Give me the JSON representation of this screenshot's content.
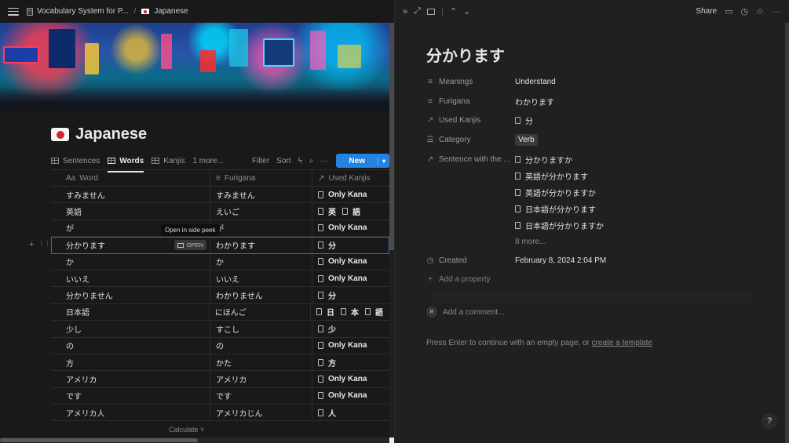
{
  "breadcrumb": {
    "workspace": "Vocabulary System for P...",
    "page": "Japanese"
  },
  "page": {
    "title": "Japanese"
  },
  "views": {
    "tabs": [
      {
        "label": "Sentences",
        "active": false
      },
      {
        "label": "Words",
        "active": true
      },
      {
        "label": "Kanjis",
        "active": false
      }
    ],
    "more": "1 more...",
    "filter": "Filter",
    "sort": "Sort",
    "new": "New"
  },
  "table": {
    "headers": [
      "Word",
      "Furigana",
      "Used Kanjis"
    ],
    "header_prefix": "Aa",
    "rows": [
      {
        "word": "すみません",
        "furigana": "すみません",
        "kanjis": [],
        "kana": "Only Kana"
      },
      {
        "word": "英語",
        "furigana": "えいご",
        "kanjis": [
          "英",
          "語"
        ],
        "kana": ""
      },
      {
        "word": "が",
        "furigana": "が",
        "kanjis": [],
        "kana": "Only Kana"
      },
      {
        "word": "分かります",
        "furigana": "わかります",
        "kanjis": [
          "分"
        ],
        "kana": ""
      },
      {
        "word": "か",
        "furigana": "か",
        "kanjis": [],
        "kana": "Only Kana"
      },
      {
        "word": "いいえ",
        "furigana": "いいえ",
        "kanjis": [],
        "kana": "Only Kana"
      },
      {
        "word": "分かりません",
        "furigana": "わかりません",
        "kanjis": [
          "分"
        ],
        "kana": ""
      },
      {
        "word": "日本語",
        "furigana": "にほんご",
        "kanjis": [
          "日",
          "本",
          "語"
        ],
        "kana": ""
      },
      {
        "word": "少し",
        "furigana": "すこし",
        "kanjis": [
          "少"
        ],
        "kana": ""
      },
      {
        "word": "の",
        "furigana": "の",
        "kanjis": [],
        "kana": "Only Kana"
      },
      {
        "word": "方",
        "furigana": "かた",
        "kanjis": [
          "方"
        ],
        "kana": ""
      },
      {
        "word": "アメリカ",
        "furigana": "アメリカ",
        "kanjis": [],
        "kana": "Only Kana"
      },
      {
        "word": "です",
        "furigana": "です",
        "kanjis": [],
        "kana": "Only Kana"
      },
      {
        "word": "アメリカ人",
        "furigana": "アメリカじん",
        "kanjis": [
          "人"
        ],
        "kana": ""
      }
    ],
    "selected_row_index": 3,
    "open_label": "OPEN",
    "tooltip": "Open in side peek",
    "calculate": "Calculate"
  },
  "peek": {
    "share": "Share",
    "title": "分かります",
    "props": {
      "meanings_label": "Meanings",
      "meanings": "Understand",
      "furigana_label": "Furigana",
      "furigana": "わかります",
      "kanjis_label": "Used Kanjis",
      "kanji": "分",
      "category_label": "Category",
      "category": "Verb",
      "sentences_label": "Sentence with the ...",
      "sentences": [
        "分かりますか",
        "英語が分かります",
        "英語が分かりますか",
        "日本語が分かります",
        "日本語が分かりますか"
      ],
      "sentences_more": "8 more...",
      "created_label": "Created",
      "created": "February 8, 2024 2:04 PM",
      "add_property": "Add a property"
    },
    "avatar": "R",
    "comment_placeholder": "Add a comment...",
    "hint_prefix": "Press Enter to continue with an empty page, or ",
    "hint_link": "create a template",
    "help": "?"
  },
  "colors": {
    "accent": "#2383e2",
    "bg": "#191919",
    "panel": "#202020"
  }
}
